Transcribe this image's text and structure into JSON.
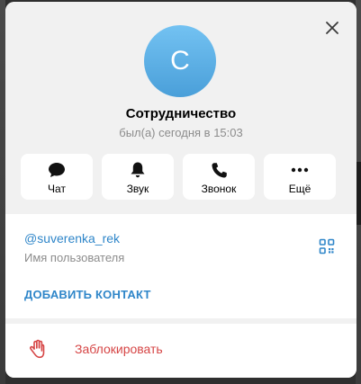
{
  "profile": {
    "avatar_letter": "С",
    "name": "Сотрудничество",
    "status": "был(а) сегодня в 15:03"
  },
  "actions": [
    {
      "label": "Чат",
      "icon": "chat-bubble-icon"
    },
    {
      "label": "Звук",
      "icon": "bell-icon"
    },
    {
      "label": "Звонок",
      "icon": "phone-icon"
    },
    {
      "label": "Ещё",
      "icon": "more-dots-icon"
    }
  ],
  "info": {
    "username": "@suverenka_rek",
    "username_caption": "Имя пользователя",
    "qr_icon": "qr-code-icon",
    "add_contact_label": "ДОБАВИТЬ КОНТАКТ"
  },
  "block": {
    "label": "Заблокировать",
    "icon": "hand-stop-icon"
  },
  "colors": {
    "accent": "#2f86c9",
    "danger": "#d64545",
    "avatar_top": "#73c2f2",
    "avatar_bottom": "#4a9fd9",
    "panel_bg": "#f1f1f1"
  }
}
